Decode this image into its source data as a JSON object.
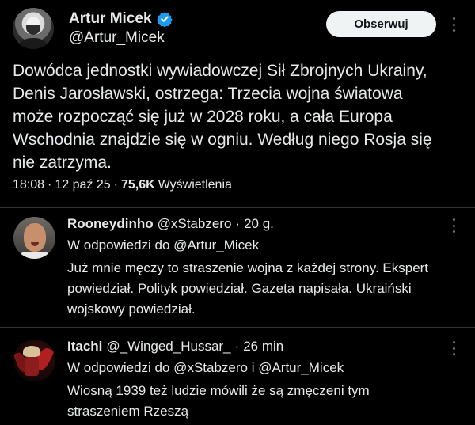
{
  "main": {
    "author_name": "Artur Micek",
    "author_handle": "@Artur_Micek",
    "follow_label": "Obserwuj",
    "text": "Dowódca jednostki wywiadowczej Sił Zbrojnych Ukrainy,\nDenis Jarosławski, ostrzega: Trzecia wojna światowa\nmoże rozpocząć się już w 2028 roku, a cała Europa\nWschodnia znajdzie się w ogniu. Według niego Rosja się\nnie zatrzyma.",
    "time": "18:08",
    "sep1": "·",
    "date": "12 paź 25",
    "sep2": "·",
    "views": "75,6K",
    "views_label": "Wyświetlenia"
  },
  "replies": [
    {
      "name": "Rooneydinho",
      "handle": "@xStabzero",
      "dot": "·",
      "time": "20 g.",
      "reply_to": "W odpowiedzi do @Artur_Micek",
      "text": "Już mnie męczy to straszenie wojna z każdej strony. Ekspert\npowiedział. Polityk powiedział. Gazeta napisała. Ukraiński\nwojskowy powiedział."
    },
    {
      "name": "Itachi",
      "handle": "@_Winged_Hussar_",
      "dot": "·",
      "time": "26 min",
      "reply_to": "W odpowiedzi do @xStabzero i @Artur_Micek",
      "text": "Wiosną 1939 też ludzie mówili że są zmęczeni tym\nstraszeniem Rzeszą"
    }
  ],
  "icons": {
    "verified": "verified-badge-icon",
    "more": "more-options-icon"
  },
  "colors": {
    "background": "#000000",
    "text": "#e7e9ea",
    "secondary": "#71767b",
    "verified": "#1d9bf0",
    "divider": "#2f3336",
    "button_bg": "#eff3f4"
  }
}
